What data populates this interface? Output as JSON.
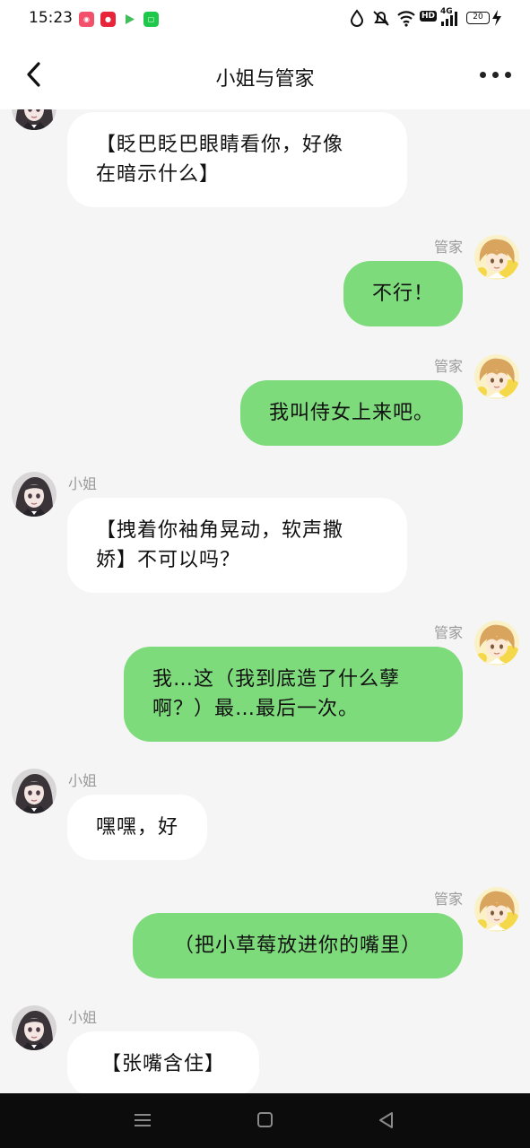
{
  "status_bar": {
    "time": "15:23",
    "network_label": "4G",
    "hd_label": "HD",
    "battery_level": "20"
  },
  "header": {
    "title": "小姐与管家"
  },
  "messages": [
    {
      "side": "left",
      "sender": "",
      "text_lines": [
        "【眨巴眨巴眼睛看你，好像",
        "在暗示什么】"
      ]
    },
    {
      "side": "right",
      "sender": "管家",
      "text_lines": [
        "不行！"
      ]
    },
    {
      "side": "right",
      "sender": "管家",
      "text_lines": [
        "我叫侍女上来吧。"
      ]
    },
    {
      "side": "left",
      "sender": "小姐",
      "text_lines": [
        "【拽着你袖角晃动，软声撒",
        "娇】不可以吗？"
      ]
    },
    {
      "side": "right",
      "sender": "管家",
      "text_lines": [
        "我…这（我到底造了什么孽",
        "啊？）最…最后一次。"
      ]
    },
    {
      "side": "left",
      "sender": "小姐",
      "text_lines": [
        "嘿嘿，好"
      ]
    },
    {
      "side": "right",
      "sender": "管家",
      "text_lines": [
        "（把小草莓放进你的嘴里）"
      ]
    },
    {
      "side": "left",
      "sender": "小姐",
      "text_lines": [
        "【张嘴含住】"
      ]
    }
  ],
  "colors": {
    "own_bubble": "#7edb7c",
    "other_bubble": "#ffffff",
    "background": "#f5f5f5",
    "sender_name": "#9a9a9a"
  },
  "icons": {
    "back": "chevron-left-icon",
    "more": "more-dots-icon",
    "lady_avatar": "dark-haired-girl-avatar",
    "butler_avatar": "blond-boy-avatar",
    "nav_menu": "menu-icon",
    "nav_home": "home-square-icon",
    "nav_back": "triangle-back-icon"
  }
}
